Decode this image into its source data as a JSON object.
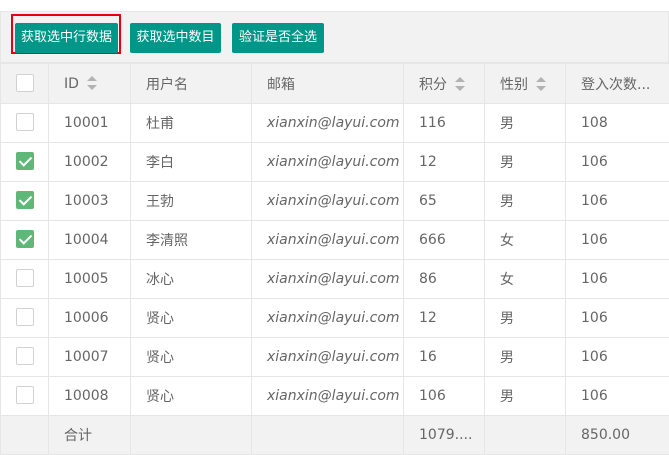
{
  "toolbar": {
    "btn_get_checked_rows": "获取选中行数据",
    "btn_get_checked_count": "获取选中数目",
    "btn_verify_all_checked": "验证是否全选"
  },
  "table": {
    "headers": {
      "id": "ID",
      "username": "用户名",
      "email": "邮箱",
      "score": "积分",
      "sex": "性别",
      "logins": "登入次数..."
    },
    "rows": [
      {
        "checked": false,
        "id": "10001",
        "username": "杜甫",
        "email": "xianxin@layui.com",
        "score": "116",
        "sex": "男",
        "logins": "108"
      },
      {
        "checked": true,
        "id": "10002",
        "username": "李白",
        "email": "xianxin@layui.com",
        "score": "12",
        "sex": "男",
        "logins": "106"
      },
      {
        "checked": true,
        "id": "10003",
        "username": "王勃",
        "email": "xianxin@layui.com",
        "score": "65",
        "sex": "男",
        "logins": "106"
      },
      {
        "checked": true,
        "id": "10004",
        "username": "李清照",
        "email": "xianxin@layui.com",
        "score": "666",
        "sex": "女",
        "logins": "106"
      },
      {
        "checked": false,
        "id": "10005",
        "username": "冰心",
        "email": "xianxin@layui.com",
        "score": "86",
        "sex": "女",
        "logins": "106"
      },
      {
        "checked": false,
        "id": "10006",
        "username": "贤心",
        "email": "xianxin@layui.com",
        "score": "12",
        "sex": "男",
        "logins": "106"
      },
      {
        "checked": false,
        "id": "10007",
        "username": "贤心",
        "email": "xianxin@layui.com",
        "score": "16",
        "sex": "男",
        "logins": "106"
      },
      {
        "checked": false,
        "id": "10008",
        "username": "贤心",
        "email": "xianxin@layui.com",
        "score": "106",
        "sex": "男",
        "logins": "106"
      }
    ],
    "footer": {
      "label": "合计",
      "score_total": "1079....",
      "logins_total": "850.00"
    }
  },
  "colors": {
    "primary": "#009688",
    "checked": "#5fb878",
    "highlight": "#e60012"
  }
}
